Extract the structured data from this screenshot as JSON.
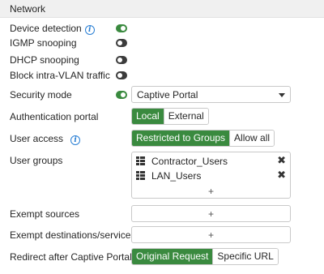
{
  "section": {
    "title": "Network"
  },
  "rows": {
    "device_detection": {
      "label": "Device detection",
      "on": true
    },
    "igmp_snooping": {
      "label": "IGMP snooping",
      "on": false
    },
    "dhcp_snooping": {
      "label": "DHCP snooping",
      "on": false
    },
    "block_intra_vlan": {
      "label": "Block intra-VLAN traffic",
      "on": false
    },
    "security_mode": {
      "label": "Security mode",
      "on": true,
      "selected": "Captive Portal"
    },
    "auth_portal": {
      "label": "Authentication portal",
      "options": [
        "Local",
        "External"
      ],
      "active": "Local"
    },
    "user_access": {
      "label": "User access",
      "options": [
        "Restricted to Groups",
        "Allow all"
      ],
      "active": "Restricted to Groups"
    },
    "user_groups": {
      "label": "User groups",
      "items": [
        "Contractor_Users",
        "LAN_Users"
      ],
      "add": "+"
    },
    "exempt_sources": {
      "label": "Exempt sources",
      "add": "+"
    },
    "exempt_destinations": {
      "label": "Exempt destinations/services",
      "add": "+"
    },
    "redirect": {
      "label": "Redirect after Captive Portal",
      "options": [
        "Original Request",
        "Specific URL"
      ],
      "active": "Original Request"
    }
  },
  "icons": {
    "info": "info-icon",
    "group": "group-icon",
    "remove": "close-icon",
    "dropdown": "chevron-down-icon"
  },
  "colors": {
    "toggle_on": "#3a8a3f",
    "toggle_off": "#3b3b3b",
    "active_segment": "#3a8a3f",
    "info": "#2a7fd4"
  }
}
